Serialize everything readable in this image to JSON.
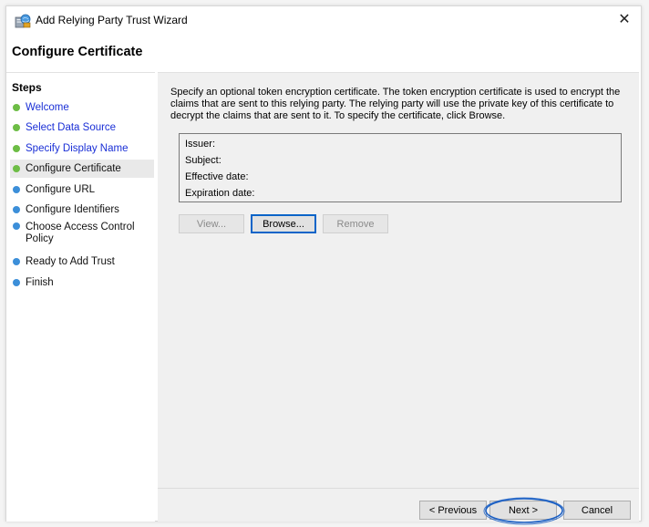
{
  "window": {
    "title": "Add Relying Party Trust Wizard",
    "close_glyph": "✕"
  },
  "page": {
    "title": "Configure Certificate"
  },
  "steps": {
    "header": "Steps",
    "items": [
      {
        "label": "Welcome",
        "state": "done"
      },
      {
        "label": "Select Data Source",
        "state": "done"
      },
      {
        "label": "Specify Display Name",
        "state": "done"
      },
      {
        "label": "Configure Certificate",
        "state": "current"
      },
      {
        "label": "Configure URL",
        "state": "todo"
      },
      {
        "label": "Configure Identifiers",
        "state": "todo"
      },
      {
        "label": "Choose Access Control Policy",
        "state": "todo"
      },
      {
        "label": "Ready to Add Trust",
        "state": "todo"
      },
      {
        "label": "Finish",
        "state": "todo"
      }
    ]
  },
  "content": {
    "description": "Specify an optional token encryption certificate.  The token encryption certificate is used to encrypt the claims that are sent to this relying party.  The relying party will use the private key of this certificate to decrypt the claims that are sent to it.  To specify the certificate, click Browse.",
    "certificate": {
      "issuer_label": "Issuer:",
      "subject_label": "Subject:",
      "effective_label": "Effective date:",
      "expiration_label": "Expiration date:"
    },
    "buttons": {
      "view": "View...",
      "browse": "Browse...",
      "remove": "Remove"
    }
  },
  "footer": {
    "previous": "< Previous",
    "next": "Next >",
    "cancel": "Cancel"
  },
  "colors": {
    "completed_step_dot": "#6dbd45",
    "pending_step_dot": "#3c8fd9",
    "completed_step_text": "#1a2fd6",
    "highlight_ring": "#1a5fc4"
  }
}
